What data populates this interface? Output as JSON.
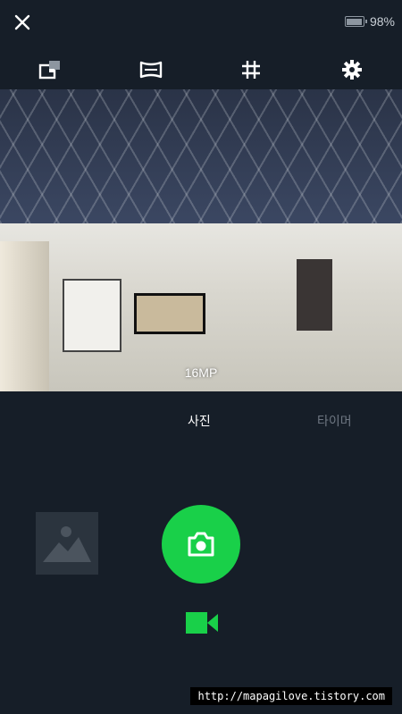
{
  "status": {
    "battery_percent": 98,
    "battery_text": "98%"
  },
  "toolbar": {
    "icons": [
      "switch-camera-icon",
      "panorama-icon",
      "grid-icon",
      "settings-icon"
    ]
  },
  "viewfinder": {
    "resolution_label": "16MP"
  },
  "modes": {
    "photo": "사진",
    "timer": "타이머",
    "selected": "photo"
  },
  "colors": {
    "background": "#161e28",
    "accent": "#19d049",
    "inactive_text": "#6e7782"
  },
  "watermark": "http://mapagilove.tistory.com"
}
